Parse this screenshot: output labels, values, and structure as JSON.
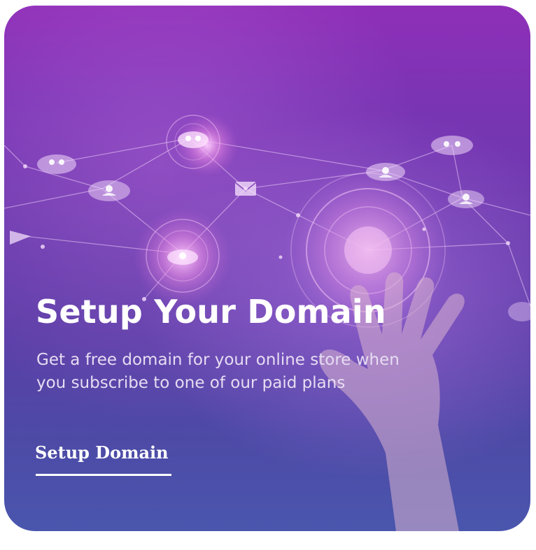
{
  "hero": {
    "title": "Setup Your Domain",
    "description": "Get a free domain for your online store when you subscribe to one of our paid plans",
    "cta_label": "Setup Domain"
  },
  "colors": {
    "gradient_top": "#8f2fb8",
    "gradient_bottom": "#4a56ad",
    "text": "#ffffff"
  },
  "icons": [
    "user-node-icon",
    "mail-icon",
    "hand-image"
  ]
}
